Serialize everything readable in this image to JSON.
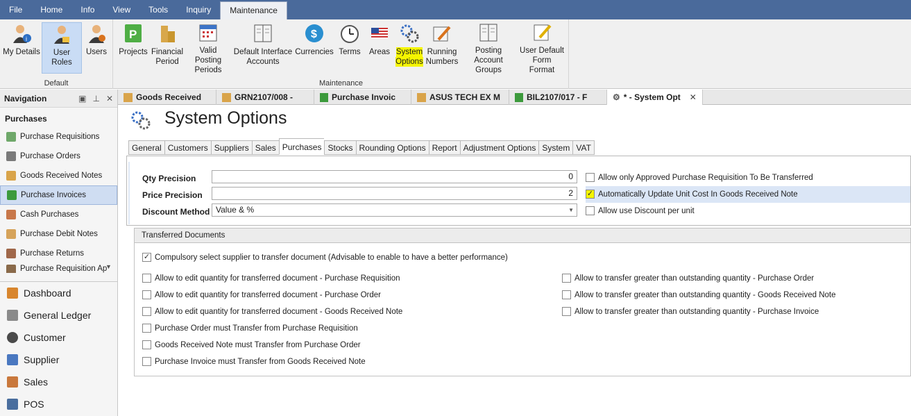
{
  "menu": {
    "items": [
      "File",
      "Home",
      "Info",
      "View",
      "Tools",
      "Inquiry",
      "Maintenance"
    ],
    "active": "Maintenance"
  },
  "ribbon": {
    "default_group": {
      "caption": "Default",
      "buttons": [
        "My Details",
        "User Roles",
        "Users"
      ]
    },
    "maintenance_group": {
      "caption": "Maintenance",
      "buttons": [
        {
          "l1": "Projects",
          "l2": ""
        },
        {
          "l1": "Financial",
          "l2": "Period"
        },
        {
          "l1": "Valid Posting",
          "l2": "Periods"
        },
        {
          "l1": "Default Interface",
          "l2": "Accounts"
        },
        {
          "l1": "Currencies",
          "l2": ""
        },
        {
          "l1": "Terms",
          "l2": ""
        },
        {
          "l1": "Areas",
          "l2": ""
        },
        {
          "l1": "System",
          "l2": "Options"
        },
        {
          "l1": "Running",
          "l2": "Numbers"
        },
        {
          "l1": "Posting",
          "l2": "Account Groups"
        },
        {
          "l1": "User Default",
          "l2": "Form Format"
        }
      ]
    }
  },
  "navigation": {
    "title": "Navigation",
    "section": "Purchases",
    "items": [
      "Purchase Requisitions",
      "Purchase Orders",
      "Goods Received Notes",
      "Purchase Invoices",
      "Cash Purchases",
      "Purchase Debit Notes",
      "Purchase Returns",
      "Purchase Requisition Ap"
    ],
    "modules": [
      "Dashboard",
      "General Ledger",
      "Customer",
      "Supplier",
      "Sales",
      "POS"
    ]
  },
  "doc_tabs": [
    "Goods Received",
    "GRN2107/008 -",
    "Purchase Invoic",
    "ASUS TECH EX M",
    "BIL2107/017 - F",
    "* - System Opt"
  ],
  "page": {
    "title": "System Options",
    "tabs": [
      "General",
      "Customers",
      "Suppliers",
      "Sales",
      "Purchases",
      "Stocks",
      "Rounding Options",
      "Report",
      "Adjustment Options",
      "System",
      "VAT"
    ],
    "active_tab": "Purchases",
    "qty_precision": {
      "label": "Qty Precision",
      "value": "0"
    },
    "price_precision": {
      "label": "Price Precision",
      "value": "2"
    },
    "discount_method": {
      "label": "Discount Method",
      "value": "Value & %"
    },
    "options": {
      "approved_only": {
        "label": "Allow only Approved Purchase Requisition To Be Transferred",
        "checked": false
      },
      "auto_update": {
        "label": "Automatically Update Unit Cost In Goods Received Note",
        "checked": true
      },
      "discount_per_unit": {
        "label": "Allow use Discount per unit",
        "checked": false
      }
    },
    "transferred": {
      "title": "Transferred Documents",
      "compulsory": {
        "label": "Compulsory select supplier to transfer document (Advisable to enable to have a better performance)",
        "checked": true
      },
      "left": [
        "Allow to edit quantity for transferred document - Purchase Requisition",
        "Allow to edit quantity for transferred document - Purchase Order",
        "Allow to edit quantity for transferred document - Goods Received Note",
        "Purchase Order must Transfer from Purchase Requisition",
        "Goods Received Note must Transfer from Purchase Order",
        "Purchase Invoice must Transfer from Goods Received Note"
      ],
      "right": [
        "Allow to transfer greater than outstanding quantity - Purchase Order",
        "Allow to transfer greater than outstanding quantity - Goods Received Note",
        "Allow to transfer greater than outstanding quantity - Purchase Invoice"
      ]
    }
  },
  "colors": {
    "menubar": "#4a6a9b",
    "highlight": "#f5f500",
    "selection": "#cfddf2"
  }
}
